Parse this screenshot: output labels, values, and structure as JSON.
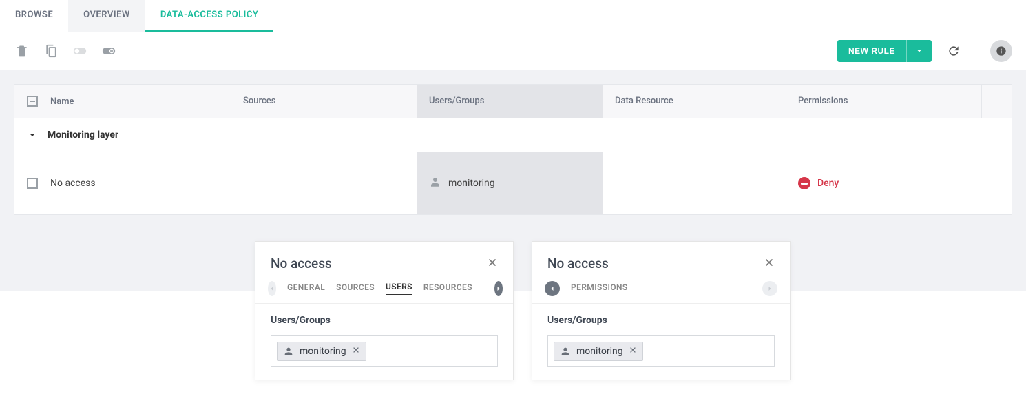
{
  "tabs": {
    "browse": "BROWSE",
    "overview": "OVERVIEW",
    "data_access_policy": "DATA-ACCESS POLICY"
  },
  "toolbar": {
    "new_rule": "NEW RULE"
  },
  "table": {
    "headers": {
      "name": "Name",
      "sources": "Sources",
      "users": "Users/Groups",
      "data_resource": "Data Resource",
      "permissions": "Permissions"
    },
    "group": "Monitoring layer",
    "row": {
      "name": "No access",
      "user": "monitoring",
      "permission": "Deny"
    }
  },
  "panel1": {
    "title": "No access",
    "tabs": {
      "general": "GENERAL",
      "sources": "SOURCES",
      "users": "USERS",
      "resources": "RESOURCES"
    },
    "section": "Users/Groups",
    "chip": "monitoring"
  },
  "panel2": {
    "title": "No access",
    "tabs": {
      "permissions": "PERMISSIONS"
    },
    "section": "Users/Groups",
    "chip": "monitoring"
  }
}
